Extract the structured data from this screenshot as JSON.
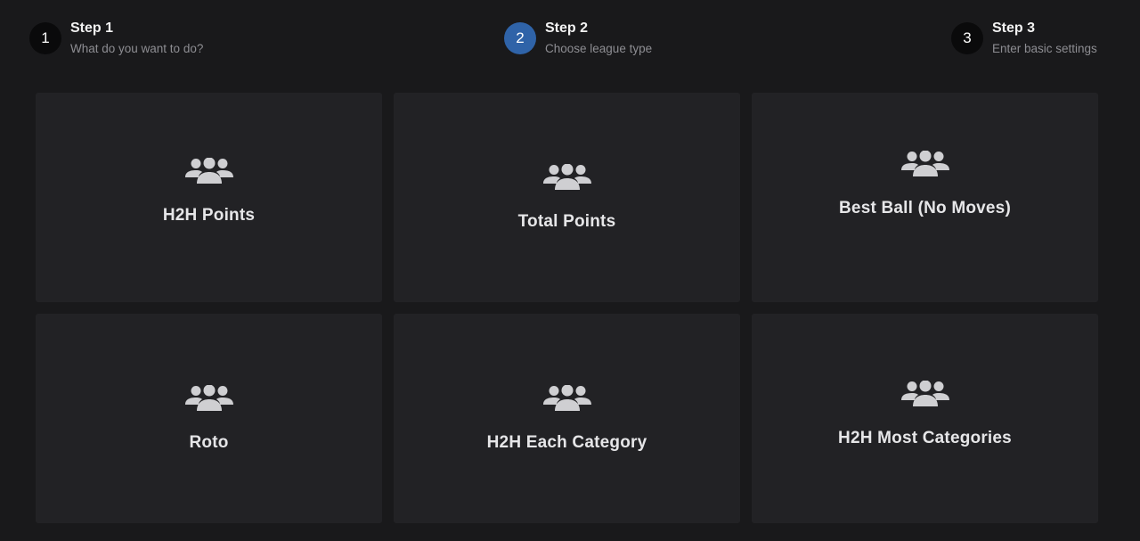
{
  "stepper": {
    "steps": [
      {
        "number": "1",
        "title": "Step 1",
        "subtitle": "What do you want to do?",
        "active": false
      },
      {
        "number": "2",
        "title": "Step 2",
        "subtitle": "Choose league type",
        "active": true
      },
      {
        "number": "3",
        "title": "Step 3",
        "subtitle": "Enter basic settings",
        "active": false
      }
    ]
  },
  "league_types": [
    {
      "label": "H2H Points",
      "icon": "group-icon"
    },
    {
      "label": "Total Points",
      "icon": "group-icon"
    },
    {
      "label": "Best Ball (No Moves)",
      "icon": "group-icon"
    },
    {
      "label": "Roto",
      "icon": "group-icon"
    },
    {
      "label": "H2H Each Category",
      "icon": "group-icon"
    },
    {
      "label": "H2H Most Categories",
      "icon": "group-icon"
    }
  ],
  "colors": {
    "background": "#19191b",
    "card": "#222225",
    "active_step": "#2f63a8",
    "icon": "#cfcfd2"
  }
}
